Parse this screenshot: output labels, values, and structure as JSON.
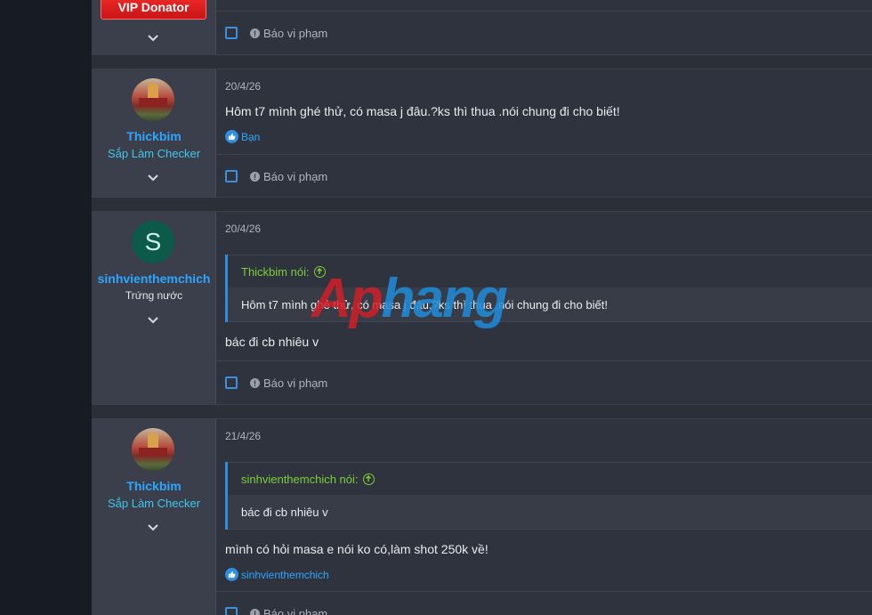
{
  "top_post": {
    "badge": "VIP Donator",
    "report_label": "Báo vi phạm"
  },
  "posts": [
    {
      "username": "Thickbim",
      "user_title": "Sắp Làm Checker",
      "date": "20/4/26",
      "message": "Hôm t7 mình ghé thử, có masa j đâu.?ks thì thua .nói chung đi cho biết!",
      "like_text": "Bạn",
      "report_label": "Báo vi phạm"
    },
    {
      "username": "sinhvienthemchich",
      "avatar_letter": "S",
      "user_title": "Trứng nước",
      "date": "20/4/26",
      "quote_author": "Thickbim nói:",
      "quote_text": "Hôm t7 mình ghé thử, có masa j đâu.?ks thì thua .nói chung đi cho biết!",
      "message": "bác đi cb nhiêu v",
      "report_label": "Báo vi phạm"
    },
    {
      "username": "Thickbim",
      "user_title": "Sắp Làm Checker",
      "date": "21/4/26",
      "quote_author": "sinhvienthemchich nói:",
      "quote_text": "bác đi cb nhiêu v",
      "message": "mình có hỏi masa e nói ko có,làm shot 250k về!",
      "like_text": "sinhvienthemchich",
      "report_label": "Báo vi phạm"
    }
  ],
  "watermark": {
    "part1": "Ap",
    "part2": "hang"
  },
  "colors": {
    "link": "#2ea6ff",
    "quote_author": "#7ccf3a",
    "vip_badge": "#e61e1e",
    "checkbox": "#3d8fe0"
  }
}
